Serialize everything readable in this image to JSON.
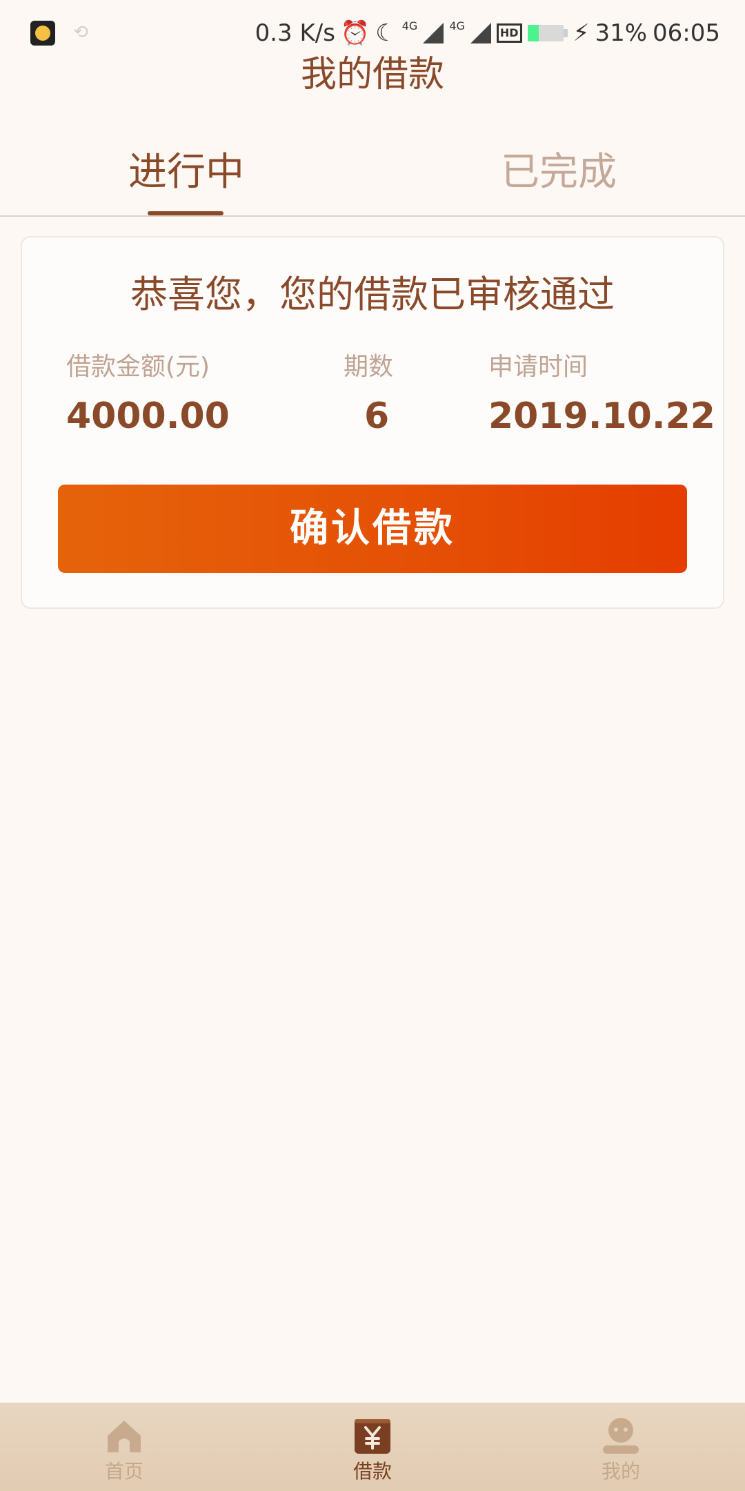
{
  "status_bar": {
    "speed": "0.3 K/s",
    "net_4g_a": "4G",
    "net_4g_b": "4G",
    "hd": "HD",
    "battery_percent": "31%",
    "battery_level": 0.31,
    "time": "06:05"
  },
  "header": {
    "title": "我的借款"
  },
  "tabs": [
    {
      "label": "进行中",
      "active": true
    },
    {
      "label": "已完成",
      "active": false
    }
  ],
  "loan_card": {
    "title": "恭喜您，您的借款已审核通过",
    "amount_label": "借款金额(元)",
    "amount_value": "4000.00",
    "term_label": "期数",
    "term_value": "6",
    "date_label": "申请时间",
    "date_value": "2019.10.22",
    "confirm_label": "确认借款"
  },
  "bottom_nav": [
    {
      "label": "首页",
      "icon": "home-icon",
      "active": false
    },
    {
      "label": "借款",
      "icon": "yuan-icon",
      "active": true
    },
    {
      "label": "我的",
      "icon": "user-icon",
      "active": false
    }
  ],
  "colors": {
    "background": "#fdf8f4",
    "primary_text": "#8a4a2a",
    "muted_text": "#c0a392",
    "button_start": "#e5630a",
    "button_end": "#e53d00",
    "nav_bg": "#e5d1ba"
  }
}
